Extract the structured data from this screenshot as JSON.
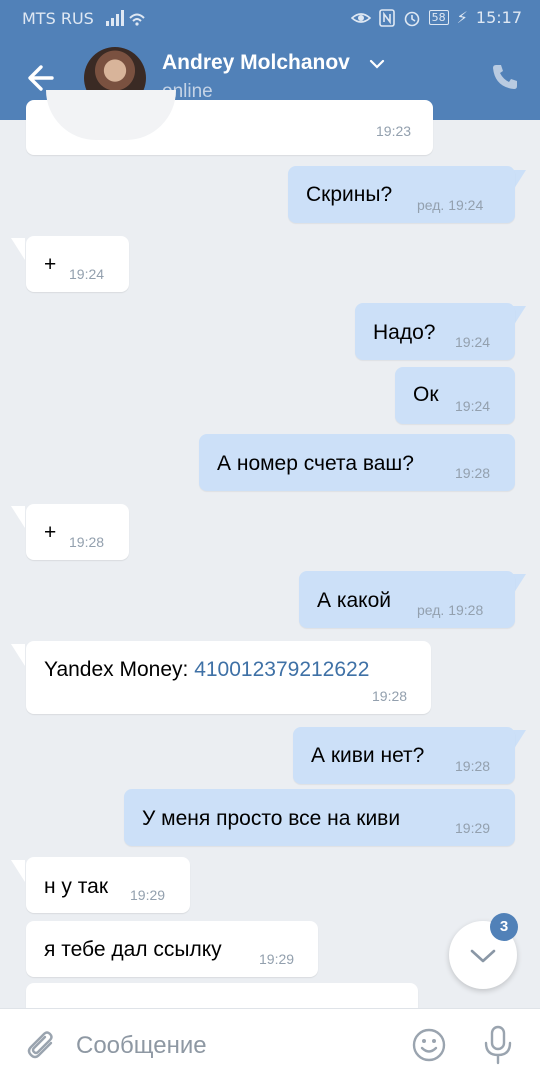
{
  "status_bar": {
    "carrier": "MTS RUS",
    "battery": "58",
    "time": "15:17"
  },
  "header": {
    "name": "Andrey Molchanov",
    "status": "online"
  },
  "messages": [
    {
      "dir": "in",
      "text": "",
      "time": "19:23"
    },
    {
      "dir": "out",
      "text": "Скрины?",
      "time": "ред. 19:24"
    },
    {
      "dir": "in",
      "text": "+",
      "time": "19:24"
    },
    {
      "dir": "out",
      "text": "Надо?",
      "time": "19:24"
    },
    {
      "dir": "out",
      "text": "Ок",
      "time": "19:24"
    },
    {
      "dir": "out",
      "text": "А номер счета ваш?",
      "time": "19:28"
    },
    {
      "dir": "in",
      "text": "+",
      "time": "19:28"
    },
    {
      "dir": "out",
      "text": "А какой",
      "time": "ред. 19:28"
    },
    {
      "dir": "in",
      "text": "Yandex Money: ",
      "link": "410012379212622",
      "time": "19:28"
    },
    {
      "dir": "out",
      "text": "А киви нет?",
      "time": "19:28"
    },
    {
      "dir": "out",
      "text": "У меня просто все на киви",
      "time": "19:29"
    },
    {
      "dir": "in",
      "text": "н у так",
      "time": "19:29"
    },
    {
      "dir": "in",
      "text": "я тебе дал ссылку",
      "time": "19:29"
    }
  ],
  "scroll_down": {
    "unread": "3"
  },
  "composer": {
    "placeholder": "Сообщение"
  },
  "colors": {
    "header": "#5181b8",
    "background": "#ebeef2",
    "outgoing_bubble": "#cce0f8",
    "incoming_bubble": "#ffffff",
    "link": "#3f71a6"
  },
  "icons": {
    "back": "back-arrow-icon",
    "call": "phone-icon",
    "attach": "paperclip-icon",
    "emoji": "smiley-icon",
    "voice": "microphone-icon",
    "scroll": "chevron-down-icon"
  }
}
